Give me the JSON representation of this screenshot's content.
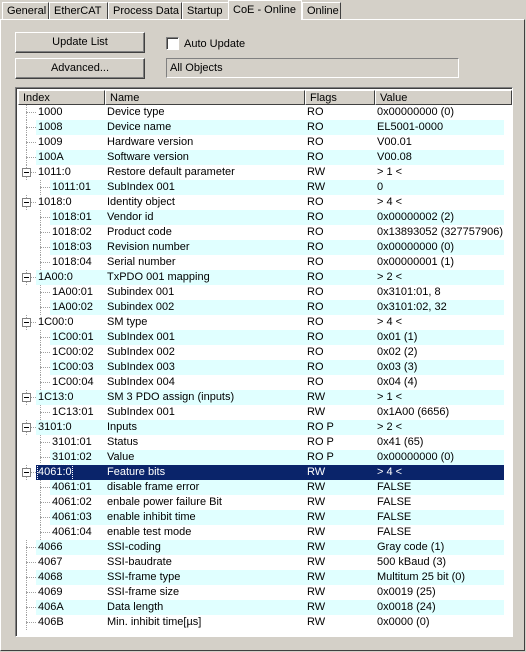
{
  "tabs": [
    {
      "label": "General",
      "active": false
    },
    {
      "label": "EtherCAT",
      "active": false
    },
    {
      "label": "Process Data",
      "active": false
    },
    {
      "label": "Startup",
      "active": false
    },
    {
      "label": "CoE - Online",
      "active": true
    },
    {
      "label": "Online",
      "active": false
    }
  ],
  "toolbar": {
    "update_list_label": "Update List",
    "advanced_label": "Advanced...",
    "auto_update_label": "Auto Update",
    "auto_update_checked": false,
    "filter_value": "All Objects"
  },
  "columns": [
    "Index",
    "Name",
    "Flags",
    "Value"
  ],
  "rows": [
    {
      "index": "1000",
      "name": "Device type",
      "flags": "RO",
      "value": "0x00000000 (0)",
      "level": 0,
      "expander": false
    },
    {
      "index": "1008",
      "name": "Device name",
      "flags": "RO",
      "value": "EL5001-0000",
      "level": 0,
      "expander": false
    },
    {
      "index": "1009",
      "name": "Hardware version",
      "flags": "RO",
      "value": "V00.01",
      "level": 0,
      "expander": false
    },
    {
      "index": "100A",
      "name": "Software version",
      "flags": "RO",
      "value": "V00.08",
      "level": 0,
      "expander": false
    },
    {
      "index": "1011:0",
      "name": "Restore default parameter",
      "flags": "RW",
      "value": "> 1 <",
      "level": 0,
      "expander": true
    },
    {
      "index": "1011:01",
      "name": "SubIndex 001",
      "flags": "RW",
      "value": "0",
      "level": 1,
      "expander": false
    },
    {
      "index": "1018:0",
      "name": "Identity object",
      "flags": "RO",
      "value": "> 4 <",
      "level": 0,
      "expander": true
    },
    {
      "index": "1018:01",
      "name": "Vendor id",
      "flags": "RO",
      "value": "0x00000002 (2)",
      "level": 1,
      "expander": false
    },
    {
      "index": "1018:02",
      "name": "Product code",
      "flags": "RO",
      "value": "0x13893052 (327757906)",
      "level": 1,
      "expander": false
    },
    {
      "index": "1018:03",
      "name": "Revision number",
      "flags": "RO",
      "value": "0x00000000 (0)",
      "level": 1,
      "expander": false
    },
    {
      "index": "1018:04",
      "name": "Serial number",
      "flags": "RO",
      "value": "0x00000001 (1)",
      "level": 1,
      "expander": false
    },
    {
      "index": "1A00:0",
      "name": "TxPDO 001 mapping",
      "flags": "RO",
      "value": "> 2 <",
      "level": 0,
      "expander": true
    },
    {
      "index": "1A00:01",
      "name": "Subindex 001",
      "flags": "RO",
      "value": "0x3101:01, 8",
      "level": 1,
      "expander": false
    },
    {
      "index": "1A00:02",
      "name": "Subindex 002",
      "flags": "RO",
      "value": "0x3101:02, 32",
      "level": 1,
      "expander": false
    },
    {
      "index": "1C00:0",
      "name": "SM type",
      "flags": "RO",
      "value": "> 4 <",
      "level": 0,
      "expander": true
    },
    {
      "index": "1C00:01",
      "name": "SubIndex 001",
      "flags": "RO",
      "value": "0x01 (1)",
      "level": 1,
      "expander": false
    },
    {
      "index": "1C00:02",
      "name": "SubIndex 002",
      "flags": "RO",
      "value": "0x02 (2)",
      "level": 1,
      "expander": false
    },
    {
      "index": "1C00:03",
      "name": "SubIndex 003",
      "flags": "RO",
      "value": "0x03 (3)",
      "level": 1,
      "expander": false
    },
    {
      "index": "1C00:04",
      "name": "SubIndex 004",
      "flags": "RO",
      "value": "0x04 (4)",
      "level": 1,
      "expander": false
    },
    {
      "index": "1C13:0",
      "name": "SM 3 PDO assign (inputs)",
      "flags": "RW",
      "value": "> 1 <",
      "level": 0,
      "expander": true
    },
    {
      "index": "1C13:01",
      "name": "SubIndex 001",
      "flags": "RW",
      "value": "0x1A00 (6656)",
      "level": 1,
      "expander": false
    },
    {
      "index": "3101:0",
      "name": "Inputs",
      "flags": "RO P",
      "value": "> 2 <",
      "level": 0,
      "expander": true
    },
    {
      "index": "3101:01",
      "name": "Status",
      "flags": "RO P",
      "value": "0x41 (65)",
      "level": 1,
      "expander": false
    },
    {
      "index": "3101:02",
      "name": "Value",
      "flags": "RO P",
      "value": "0x00000000 (0)",
      "level": 1,
      "expander": false
    },
    {
      "index": "4061:0",
      "name": "Feature bits",
      "flags": "RW",
      "value": "> 4 <",
      "level": 0,
      "expander": true,
      "selected": true
    },
    {
      "index": "4061:01",
      "name": "disable frame error",
      "flags": "RW",
      "value": "FALSE",
      "level": 1,
      "expander": false
    },
    {
      "index": "4061:02",
      "name": "enbale power failure Bit",
      "flags": "RW",
      "value": "FALSE",
      "level": 1,
      "expander": false
    },
    {
      "index": "4061:03",
      "name": "enable inhibit time",
      "flags": "RW",
      "value": "FALSE",
      "level": 1,
      "expander": false
    },
    {
      "index": "4061:04",
      "name": "enable test mode",
      "flags": "RW",
      "value": "FALSE",
      "level": 1,
      "expander": false
    },
    {
      "index": "4066",
      "name": "SSI-coding",
      "flags": "RW",
      "value": "Gray code (1)",
      "level": 0,
      "expander": false
    },
    {
      "index": "4067",
      "name": "SSI-baudrate",
      "flags": "RW",
      "value": "500 kBaud (3)",
      "level": 0,
      "expander": false
    },
    {
      "index": "4068",
      "name": "SSI-frame type",
      "flags": "RW",
      "value": "Multitum 25 bit (0)",
      "level": 0,
      "expander": false
    },
    {
      "index": "4069",
      "name": "SSI-frame size",
      "flags": "RW",
      "value": "0x0019 (25)",
      "level": 0,
      "expander": false
    },
    {
      "index": "406A",
      "name": "Data length",
      "flags": "RW",
      "value": "0x0018 (24)",
      "level": 0,
      "expander": false
    },
    {
      "index": "406B",
      "name": "Min. inhibit time[µs]",
      "flags": "RW",
      "value": "0x0000 (0)",
      "level": 0,
      "expander": false
    }
  ]
}
